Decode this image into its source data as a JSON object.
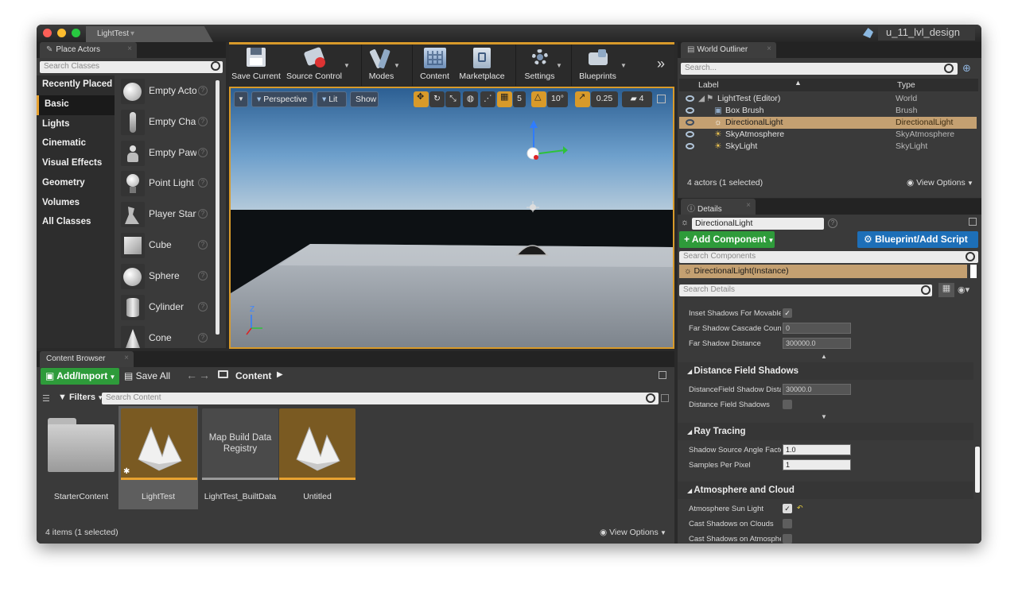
{
  "window": {
    "document_tab": "LightTest",
    "project_name": "u_11_lvl_design"
  },
  "place_actors": {
    "tab_label": "Place Actors",
    "search_placeholder": "Search Classes",
    "categories": [
      {
        "label": "Recently Placed",
        "selected": false
      },
      {
        "label": "Basic",
        "selected": true
      },
      {
        "label": "Lights",
        "selected": false
      },
      {
        "label": "Cinematic",
        "selected": false
      },
      {
        "label": "Visual Effects",
        "selected": false
      },
      {
        "label": "Geometry",
        "selected": false
      },
      {
        "label": "Volumes",
        "selected": false
      },
      {
        "label": "All Classes",
        "selected": false
      }
    ],
    "actors": [
      {
        "label": "Empty Actor",
        "icon": "sphere-icon"
      },
      {
        "label": "Empty Character",
        "icon": "character-icon"
      },
      {
        "label": "Empty Pawn",
        "icon": "pawn-icon"
      },
      {
        "label": "Point Light",
        "icon": "light-bulb-icon"
      },
      {
        "label": "Player Start",
        "icon": "player-start-icon"
      },
      {
        "label": "Cube",
        "icon": "cube-icon"
      },
      {
        "label": "Sphere",
        "icon": "sphere-icon"
      },
      {
        "label": "Cylinder",
        "icon": "cylinder-icon"
      },
      {
        "label": "Cone",
        "icon": "cone-icon"
      }
    ]
  },
  "toolbar": {
    "buttons": [
      {
        "label": "Save Current",
        "icon": "save-icon"
      },
      {
        "label": "Source Control",
        "icon": "source-control-icon"
      },
      {
        "label": "Modes",
        "icon": "modes-icon"
      },
      {
        "label": "Content",
        "icon": "content-icon"
      },
      {
        "label": "Marketplace",
        "icon": "marketplace-icon"
      },
      {
        "label": "Settings",
        "icon": "settings-icon"
      },
      {
        "label": "Blueprints",
        "icon": "blueprints-icon"
      }
    ],
    "overflow": "»"
  },
  "viewport": {
    "perspective_label": "Perspective",
    "lit_label": "Lit",
    "show_label": "Show",
    "grid_snap": "5",
    "rotation_snap": "10°",
    "scale_snap": "0.25",
    "camera_speed": "4",
    "axis_z": "Z"
  },
  "world_outliner": {
    "tab_label": "World Outliner",
    "search_placeholder": "Search...",
    "col_label": "Label",
    "col_type": "Type",
    "rows": [
      {
        "label": "LightTest (Editor)",
        "type": "World",
        "selected": false
      },
      {
        "label": "Box Brush",
        "type": "Brush",
        "selected": false
      },
      {
        "label": "DirectionalLight",
        "type": "DirectionalLight",
        "selected": true
      },
      {
        "label": "SkyAtmosphere",
        "type": "SkyAtmosphere",
        "selected": false
      },
      {
        "label": "SkyLight",
        "type": "SkyLight",
        "selected": false
      }
    ],
    "status": "4 actors (1 selected)",
    "view_options": "View Options"
  },
  "details": {
    "tab_label": "Details",
    "name_value": "DirectionalLight",
    "add_component": "+ Add Component",
    "blueprint_button": "Blueprint/Add Script",
    "search_components_placeholder": "Search Components",
    "component_instance": "DirectionalLight(Instance)",
    "search_details_placeholder": "Search Details",
    "props_top": [
      {
        "label": "Inset Shadows For Movable Objects",
        "kind": "check",
        "checked": true
      },
      {
        "label": "Far Shadow Cascade Count",
        "kind": "num",
        "value": "0"
      },
      {
        "label": "Far Shadow Distance",
        "kind": "num",
        "value": "300000.0"
      }
    ],
    "section_dfs": "Distance Field Shadows",
    "props_dfs": [
      {
        "label": "DistanceField Shadow Distance",
        "kind": "num",
        "value": "30000.0"
      },
      {
        "label": "Distance Field Shadows",
        "kind": "check",
        "checked": false
      }
    ],
    "section_rt": "Ray Tracing",
    "props_rt": [
      {
        "label": "Shadow Source Angle Factor",
        "kind": "num",
        "value": "1.0",
        "light": true
      },
      {
        "label": "Samples Per Pixel",
        "kind": "num",
        "value": "1",
        "light": true
      }
    ],
    "section_atm": "Atmosphere and Cloud",
    "props_atm": [
      {
        "label": "Atmosphere Sun Light",
        "kind": "check",
        "checked": true
      },
      {
        "label": "Cast Shadows on Clouds",
        "kind": "check",
        "checked": false
      },
      {
        "label": "Cast Shadows on Atmosphere",
        "kind": "check",
        "checked": false
      }
    ]
  },
  "content_browser": {
    "tab_label": "Content Browser",
    "add_import": "Add/Import",
    "save_all": "Save All",
    "path_root": "Content",
    "filters": "Filters",
    "search_placeholder": "Search Content",
    "items": [
      {
        "label": "StarterContent",
        "kind": "folder",
        "selected": false
      },
      {
        "label": "LightTest",
        "kind": "map",
        "selected": true
      },
      {
        "label": "LightTest_BuiltData",
        "kind": "builtdata",
        "thumb_text": "Map Build Data Registry",
        "selected": false
      },
      {
        "label": "Untitled",
        "kind": "map",
        "selected": false
      }
    ],
    "status": "4 items (1 selected)",
    "view_options": "View Options"
  },
  "colors": {
    "accent_orange": "#e8a230",
    "green_button": "#2e9b3a",
    "blue_button": "#1d6fb8",
    "selection_tan": "#c4a071"
  }
}
